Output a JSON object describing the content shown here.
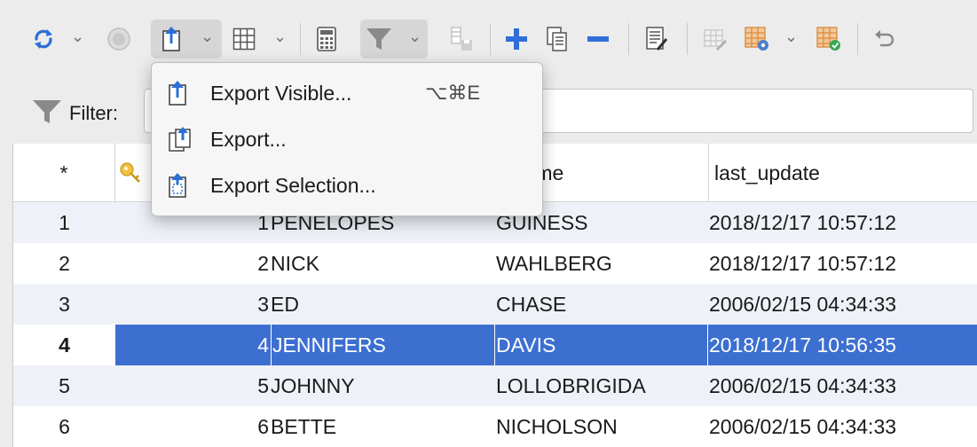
{
  "toolbar": {
    "icons": [
      "refresh-icon",
      "stop-icon",
      "export-icon",
      "grid-icon",
      "calculator-icon",
      "filter-icon",
      "save-icon",
      "add-row-icon",
      "duplicate-row-icon",
      "delete-row-icon",
      "edit-icon",
      "edit-grid-icon",
      "grid-settings-icon",
      "grid-check-icon",
      "undo-icon"
    ]
  },
  "filter": {
    "label": "Filter:",
    "value": ""
  },
  "export_menu": {
    "items": [
      {
        "label": "Export Visible...",
        "shortcut": "⌥⌘E"
      },
      {
        "label": "Export...",
        "shortcut": ""
      },
      {
        "label": "Export Selection...",
        "shortcut": ""
      }
    ]
  },
  "table": {
    "columns": [
      "*",
      "",
      "name",
      "last_update"
    ],
    "partial_column_label": "_name",
    "rows": [
      {
        "num": "1",
        "id": "1",
        "first_name": "PENELOPES",
        "last_name": "GUINESS",
        "last_update": "2018/12/17 10:57:12"
      },
      {
        "num": "2",
        "id": "2",
        "first_name": "NICK",
        "last_name": "WAHLBERG",
        "last_update": "2018/12/17 10:57:12"
      },
      {
        "num": "3",
        "id": "3",
        "first_name": "ED",
        "last_name": "CHASE",
        "last_update": "2006/02/15 04:34:33"
      },
      {
        "num": "4",
        "id": "4",
        "first_name": "JENNIFERS",
        "last_name": "DAVIS",
        "last_update": "2018/12/17 10:56:35"
      },
      {
        "num": "5",
        "id": "5",
        "first_name": "JOHNNY",
        "last_name": "LOLLOBRIGIDA",
        "last_update": "2006/02/15 04:34:33"
      },
      {
        "num": "6",
        "id": "6",
        "first_name": "BETTE",
        "last_name": "NICHOLSON",
        "last_update": "2006/02/15 04:34:33"
      }
    ],
    "selected_row": "4"
  },
  "colors": {
    "selection": "#3c6fd0",
    "alt_row": "#eef2f8",
    "add": "#2f6ed8",
    "delete": "#2f6ed8",
    "refresh": "#2b6fd6"
  }
}
